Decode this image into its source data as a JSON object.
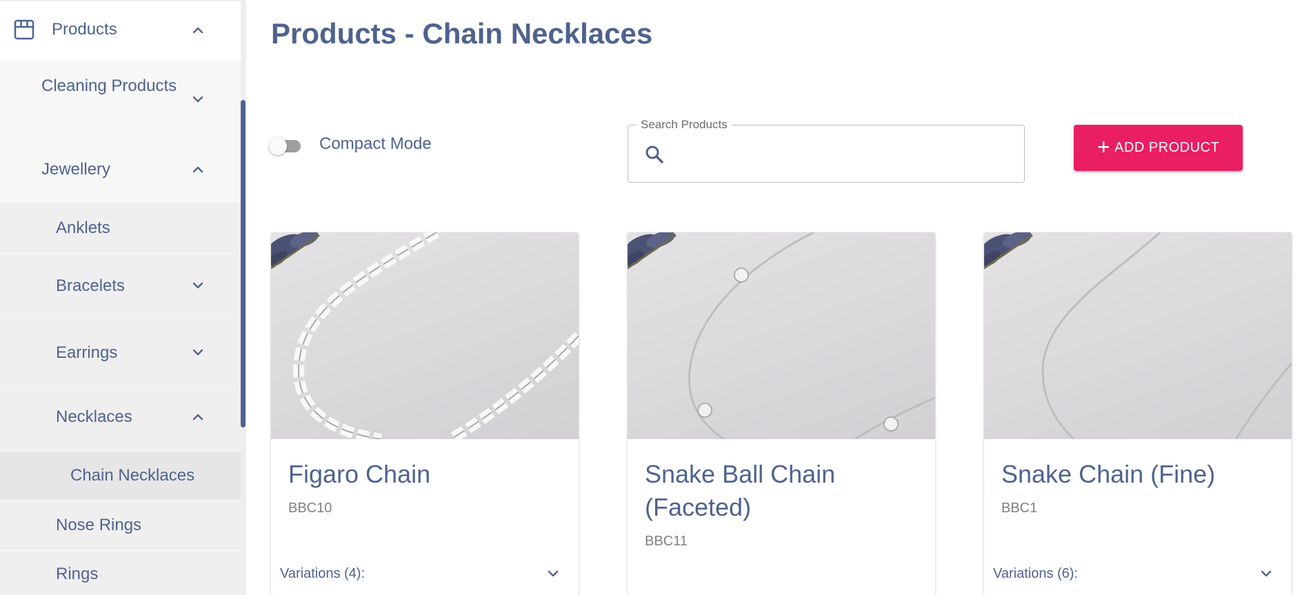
{
  "sidebar": {
    "products": "Products",
    "cleaning": "Cleaning Products",
    "jewellery": "Jewellery",
    "anklets": "Anklets",
    "bracelets": "Bracelets",
    "earrings": "Earrings",
    "necklaces": "Necklaces",
    "chain_necklaces": "Chain Necklaces",
    "nose_rings": "Nose Rings",
    "rings": "Rings"
  },
  "page": {
    "title_prefix": "Products - ",
    "title_category": "Chain Necklaces"
  },
  "controls": {
    "compact_mode_label": "Compact Mode",
    "compact_mode_on": false,
    "search_label": "Search Products",
    "search_value": "",
    "add_product_label": "ADD PRODUCT"
  },
  "products": [
    {
      "name": "Figaro Chain",
      "sku": "BBC10",
      "variations": "Variations (4):"
    },
    {
      "name": "Snake Ball Chain (Faceted)",
      "sku": "BBC11",
      "variations": ""
    },
    {
      "name": "Snake Chain (Fine)",
      "sku": "BBC1",
      "variations": "Variations (6):"
    }
  ],
  "colors": {
    "primary_text": "#4f628e",
    "accent": "#e91e63",
    "sidebar_bg": "#f7f7f7",
    "selected_bg": "#e6e6e6"
  },
  "icons": {
    "products": "store-icon",
    "expand": "chevron-down-icon",
    "collapse": "chevron-up-icon",
    "search": "search-icon",
    "add": "plus-icon"
  }
}
